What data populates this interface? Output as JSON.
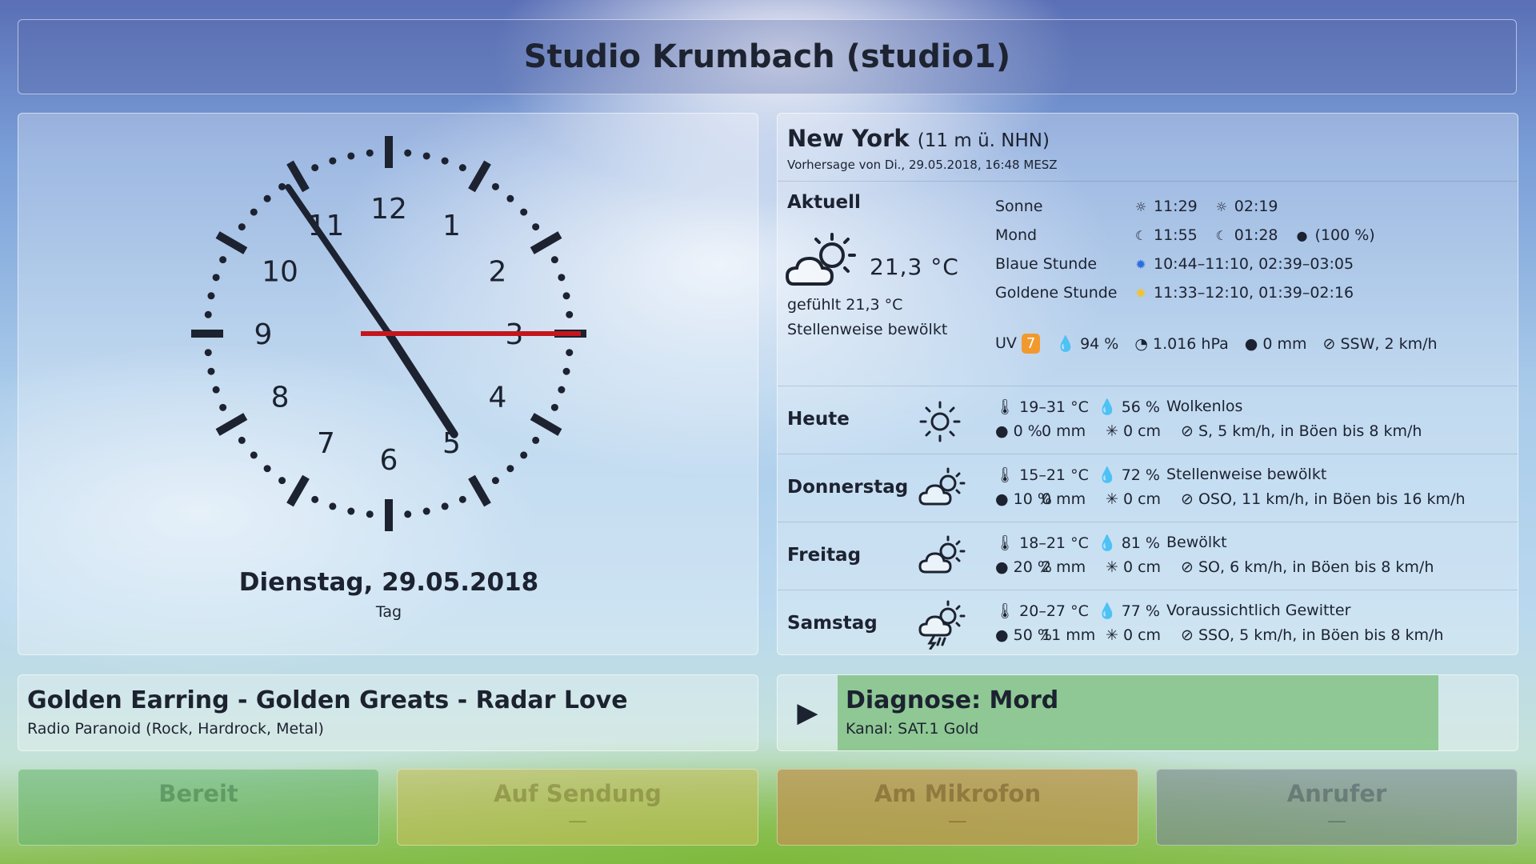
{
  "header": {
    "title": "Studio Krumbach (studio1)"
  },
  "clock": {
    "numerals": [
      "12",
      "1",
      "2",
      "3",
      "4",
      "5",
      "6",
      "7",
      "8",
      "9",
      "10",
      "11"
    ],
    "date": "Dienstag, 29.05.2018",
    "daypart": "Tag",
    "time_shown": {
      "hour": 4,
      "minute": 54,
      "second": 15
    },
    "colors": {
      "hands": "#1c2230",
      "second_hand": "#c4161c"
    }
  },
  "weather": {
    "location": "New York",
    "altitude": "(11 m ü. NHN)",
    "forecast_source": "Vorhersage von Di., 29.05.2018, 16:48 MESZ",
    "current": {
      "title": "Aktuell",
      "icon": "partly-cloudy-sun-icon",
      "temperature": "21,3 °C",
      "feels_like": "gefühlt 21,3 °C",
      "description": "Stellenweise bewölkt",
      "uv_label": "UV",
      "uv_value": "7",
      "humidity": "94 %",
      "pressure": "1.016 hPa",
      "precipitation": "0 mm",
      "wind": "SSW, 2 km/h"
    },
    "astro": [
      {
        "label": "Sonne",
        "v1": "11:29",
        "v2": "02:19",
        "v3": ""
      },
      {
        "label": "Mond",
        "v1": "11:55",
        "v2": "01:28",
        "v3": "(100 %)"
      },
      {
        "label": "Blaue Stunde",
        "v1": "10:44–11:10, 02:39–03:05",
        "v2": "",
        "v3": ""
      },
      {
        "label": "Goldene Stunde",
        "v1": "11:33–12:10, 01:39–02:16",
        "v2": "",
        "v3": ""
      }
    ],
    "days": [
      {
        "name": "Heute",
        "icon": "sun-icon",
        "temp": "19–31 °C",
        "humidity": "56 %",
        "desc": "Wolkenlos",
        "rain_prob": "0 %",
        "rain": "0 mm",
        "snow": "0 cm",
        "wind": "S, 5 km/h, in Böen bis 8 km/h"
      },
      {
        "name": "Donnerstag",
        "icon": "partly-cloudy-icon",
        "temp": "15–21 °C",
        "humidity": "72 %",
        "desc": "Stellenweise bewölkt",
        "rain_prob": "10 %",
        "rain": "0 mm",
        "snow": "0 cm",
        "wind": "OSO, 11 km/h, in Böen bis 16 km/h"
      },
      {
        "name": "Freitag",
        "icon": "partly-cloudy-icon",
        "temp": "18–21 °C",
        "humidity": "81 %",
        "desc": "Bewölkt",
        "rain_prob": "20 %",
        "rain": "2 mm",
        "snow": "0 cm",
        "wind": "SO, 6 km/h, in Böen bis 8 km/h"
      },
      {
        "name": "Samstag",
        "icon": "thunderstorm-icon",
        "temp": "20–27 °C",
        "humidity": "77 %",
        "desc": "Voraussichtlich Gewitter",
        "rain_prob": "50 %",
        "rain": "11 mm",
        "snow": "0 cm",
        "wind": "SSO, 5 km/h, in Böen bis 8 km/h"
      }
    ],
    "colors": {
      "uv_badge": "#f2992e",
      "blue_hour": "#2a6de0",
      "golden_hour": "#f2c230"
    }
  },
  "now_playing": {
    "title": "Golden Earring - Golden Greats - Radar Love",
    "station": "Radio Paranoid (Rock, Hardrock, Metal)"
  },
  "tv": {
    "title": "Diagnose: Mord",
    "channel": "Kanal: SAT.1 Gold",
    "play_icon": "play-icon"
  },
  "status": [
    {
      "label": "Bereit",
      "sub": ""
    },
    {
      "label": "Auf Sendung",
      "sub": "—"
    },
    {
      "label": "Am Mikrofon",
      "sub": "—"
    },
    {
      "label": "Anrufer",
      "sub": "—"
    }
  ]
}
